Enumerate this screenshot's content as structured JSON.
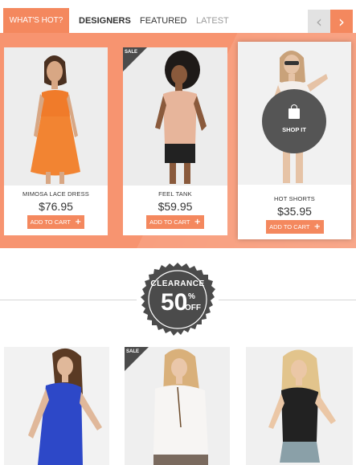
{
  "tabs": {
    "items": [
      {
        "label": "WHAT'S HOT?",
        "active": true
      },
      {
        "label": "DESIGNERS",
        "active": false
      },
      {
        "label": "FEATURED",
        "active": false
      },
      {
        "label": "LATEST",
        "active": false
      }
    ],
    "prev_icon": "chevron-left-icon",
    "next_icon": "chevron-right-icon"
  },
  "colors": {
    "accent": "#f4885e",
    "band": "#f79470",
    "badge": "#4b4b4b"
  },
  "products": [
    {
      "name": "MIMOSA LACE DRESS",
      "price": "$76.95",
      "cart_label": "ADD TO CART",
      "sale": false
    },
    {
      "name": "FEEL TANK",
      "price": "$59.95",
      "cart_label": "ADD TO CART",
      "sale": true,
      "sale_label": "SALE"
    },
    {
      "name": "HOT SHORTS",
      "price": "$35.95",
      "cart_label": "ADD TO CART",
      "sale": false,
      "shop_label": "SHOP IT",
      "shop_icon": "shopping-bag-icon"
    }
  ],
  "clearance": {
    "line1": "CLEARANCE",
    "number": "50",
    "percent": "%",
    "suffix": "OFF"
  },
  "bottom_products": [
    {
      "sale": false
    },
    {
      "sale": true,
      "sale_label": "SALE"
    },
    {
      "sale": false
    }
  ]
}
